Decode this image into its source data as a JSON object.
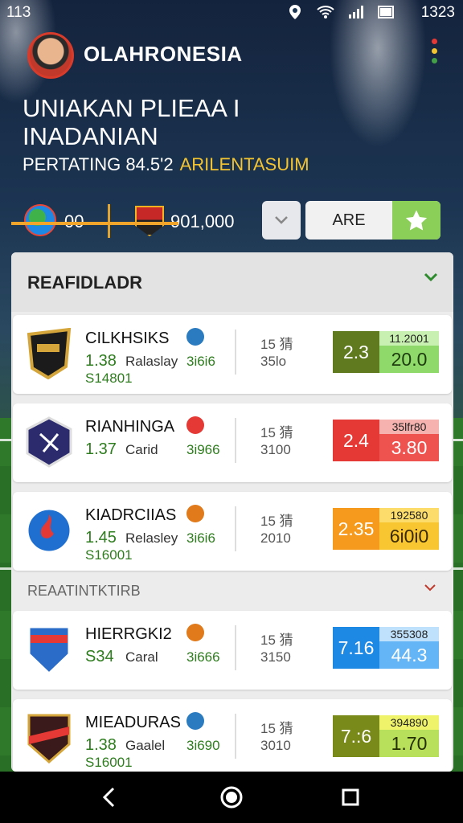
{
  "status_bar": {
    "time_left": "113",
    "time_right": "1323"
  },
  "header": {
    "app_name": "OLAHRONESIA",
    "title_line1": "UNIAKAN PLIEAA I",
    "title_line2": "INADANIAN",
    "subtitle": "PERTATING 84.5'2",
    "subtitle_accent": "ARILENTASUIM",
    "stat1_value": "00",
    "stat2_value": "901,000",
    "are_label": "ARE"
  },
  "sections": [
    {
      "label": "REAFIDLADR"
    },
    {
      "label": "REAATINTKTIRB"
    }
  ],
  "matches": [
    {
      "team": "CILKHSIKS",
      "odd": "1.38",
      "odd_label": "Ralaslay",
      "odd_alt": "3i6i6",
      "id": "S14801",
      "meta_top": "15 猜",
      "meta_bot": "35lo",
      "score_left": "2.3",
      "score_top": "11.2001",
      "score_bottom": "20.0",
      "colors": {
        "left": "#5f7a1f",
        "right_top": "#c8f0b0",
        "right_bottom": "#8fd86a",
        "text_bottom": "#1d3d0f"
      }
    },
    {
      "team": "RIANHINGA",
      "odd": "1.37",
      "odd_label": "Carid",
      "odd_alt": "3i966",
      "id": "",
      "meta_top": "15 猜",
      "meta_bot": "3100",
      "score_left": "2.4",
      "score_top": "35lfr80",
      "score_bottom": "3.80",
      "colors": {
        "left": "#e53935",
        "right_top": "#f6b2ae",
        "right_bottom": "#ef5350",
        "text_bottom": "#ffffff"
      }
    },
    {
      "team": "KIADRCIIAS",
      "odd": "1.45",
      "odd_label": "Relasley",
      "odd_alt": "3i6i6",
      "id": "S16001",
      "meta_top": "15 猜",
      "meta_bot": "2010",
      "score_left": "2.35",
      "score_top": "192580",
      "score_bottom": "6i0i0",
      "colors": {
        "left": "#f59a1c",
        "right_top": "#fcdc6a",
        "right_bottom": "#f7c630",
        "text_bottom": "#3a2a00"
      }
    },
    {
      "team": "HIERRGKI2",
      "odd": "S34",
      "odd_label": "Caral",
      "odd_alt": "3i666",
      "id": "",
      "meta_top": "15 猜",
      "meta_bot": "3150",
      "score_left": "7.16",
      "score_top": "355308",
      "score_bottom": "44.3",
      "colors": {
        "left": "#1e88e5",
        "right_top": "#bfe1fb",
        "right_bottom": "#64b5f6",
        "text_bottom": "#ffffff"
      }
    },
    {
      "team": "MIEADURAS",
      "odd": "1.38",
      "odd_label": "Gaalel",
      "odd_alt": "3i690",
      "id": "S16001",
      "meta_top": "15 猜",
      "meta_bot": "3010",
      "score_left": "7.:6",
      "score_top": "394890",
      "score_bottom": "1.70",
      "colors": {
        "left": "#7a8a1a",
        "right_top": "#eff36a",
        "right_bottom": "#b8e05a",
        "text_bottom": "#243000"
      }
    }
  ]
}
